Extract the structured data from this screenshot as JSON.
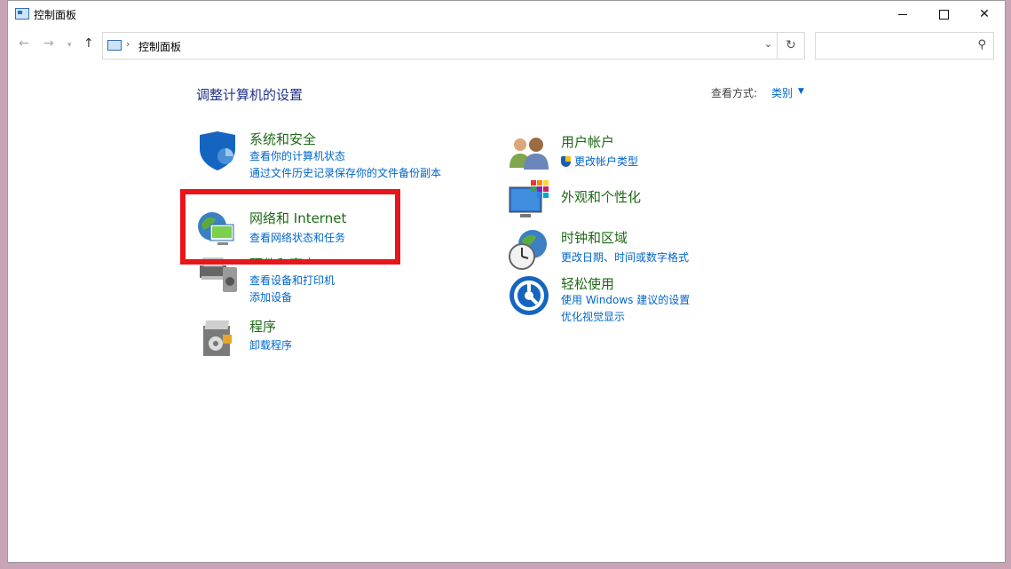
{
  "window": {
    "title": "控制面板",
    "controls": [
      "minimize",
      "maximize",
      "close"
    ]
  },
  "address_bar": {
    "path": "控制面板",
    "separator": "›",
    "refresh_icon": "refresh-icon",
    "dropdown_icon": "chevron-down-icon"
  },
  "search": {
    "placeholder": "",
    "icon": "search-icon"
  },
  "content": {
    "heading": "调整计算机的设置",
    "view_by_label": "查看方式:",
    "view_by_value": "类别"
  },
  "categories_left": [
    {
      "title": "系统和安全",
      "icon": "shield-icon",
      "links": [
        "查看你的计算机状态",
        "通过文件历史记录保存你的文件备份副本"
      ]
    },
    {
      "title": "网络和 Internet",
      "icon": "network-icon",
      "links": [
        "查看网络状态和任务"
      ]
    },
    {
      "title": "硬件和声音",
      "icon": "printer-icon",
      "links": [
        "查看设备和打印机",
        "添加设备"
      ]
    },
    {
      "title": "程序",
      "icon": "programs-icon",
      "links": [
        "卸载程序"
      ]
    }
  ],
  "categories_right": [
    {
      "title": "用户帐户",
      "icon": "users-icon",
      "links": [
        "更改帐户类型"
      ]
    },
    {
      "title": "外观和个性化",
      "icon": "appearance-icon",
      "links": []
    },
    {
      "title": "时钟和区域",
      "icon": "clock-globe-icon",
      "links": [
        "更改日期、时间或数字格式"
      ]
    },
    {
      "title": "轻松使用",
      "icon": "ease-of-access-icon",
      "links": [
        "使用 Windows 建议的设置",
        "优化视觉显示"
      ]
    }
  ],
  "colors": {
    "heading": "#1e3287",
    "category_title": "#1e6a16",
    "link": "#0066cc",
    "highlight_box": "#e8151b"
  }
}
